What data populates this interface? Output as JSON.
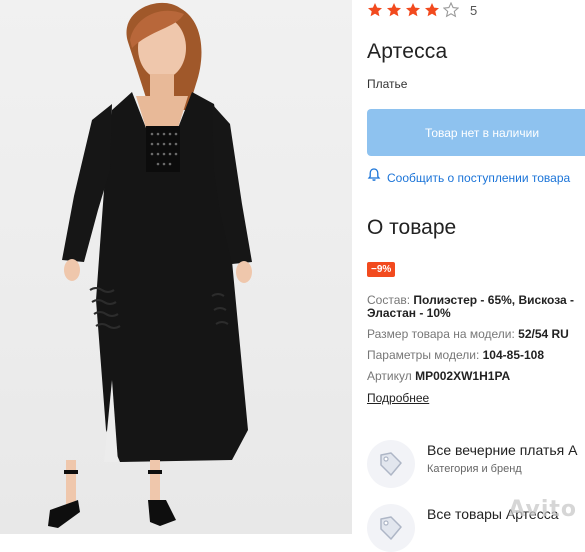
{
  "product": {
    "rating_value": 4,
    "rating_max": 5,
    "rating_count": "5",
    "title": "Артесса",
    "subtitle": "Платье",
    "unavailable_label": "Товар нет в наличии",
    "notify_label": "Сообщить о поступлении товара"
  },
  "about": {
    "title": "О товаре",
    "discount_badge": "−9%",
    "attributes": [
      {
        "label": "Состав: ",
        "value": "Полиэстер - 65%, Вискоза -"
      },
      {
        "label": "",
        "value": "Эластан - 10%"
      },
      {
        "label": "Размер товара на модели: ",
        "value": "52/54 RU"
      },
      {
        "label": "Параметры модели: ",
        "value": "104-85-108"
      },
      {
        "label": "Артикул ",
        "value": "MP002XW1H1PA"
      }
    ],
    "more_link": "Подробнее"
  },
  "categories": [
    {
      "title": "Все вечерние платья А",
      "subtitle": "Категория и бренд"
    },
    {
      "title": "Все товары Артесса",
      "subtitle": ""
    }
  ],
  "watermark": "Avito",
  "colors": {
    "star": "#f24a1e",
    "button_disabled": "#8ec2ef",
    "link": "#1b74d8",
    "badge": "#f24a1e"
  },
  "icons": {
    "rating": "star-icon",
    "notify": "bell-icon",
    "category": "tag-icon"
  }
}
